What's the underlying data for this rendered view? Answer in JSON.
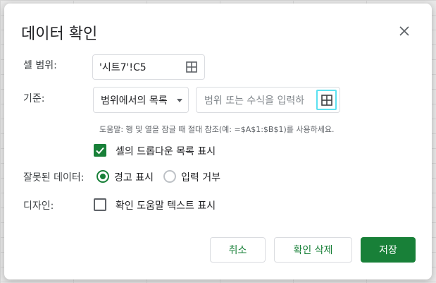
{
  "dialog": {
    "title": "데이터 확인",
    "close_icon": "close-icon"
  },
  "cell_range": {
    "label": "셀 범위:",
    "value": "'시트7'!C5",
    "icon": "grid-icon"
  },
  "criteria": {
    "label": "기준:",
    "selected_option": "범위에서의 목록",
    "formula_placeholder": "범위 또는 수식을 입력하",
    "icon": "grid-icon",
    "help_text": "도움말: 행 및 열을 잠글 때 절대 참조(예: =$A$1:$B$1)를 사용하세요."
  },
  "show_dropdown": {
    "label": "셀의 드롭다운 목록 표시",
    "checked": true
  },
  "invalid_data": {
    "label": "잘못된 데이터:",
    "options": [
      {
        "label": "경고 표시",
        "selected": true
      },
      {
        "label": "입력 거부",
        "selected": false
      }
    ]
  },
  "appearance": {
    "label": "디자인:",
    "checkbox_label": "확인 도움말 텍스트 표시",
    "checked": false
  },
  "buttons": {
    "cancel": "취소",
    "remove": "확인 삭제",
    "save": "저장"
  },
  "colors": {
    "accent": "#188038",
    "focus": "#5ce1f0"
  }
}
